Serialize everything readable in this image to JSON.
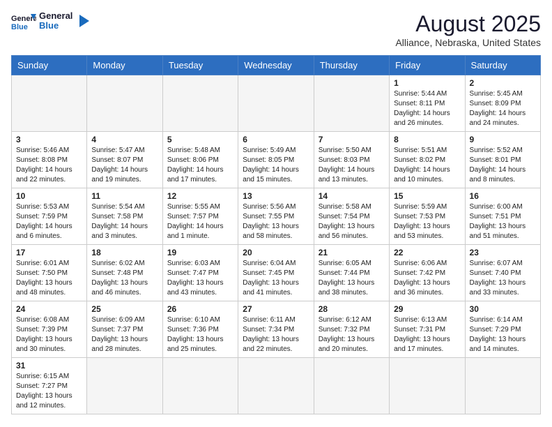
{
  "header": {
    "logo_general": "General",
    "logo_blue": "Blue",
    "month_title": "August 2025",
    "location": "Alliance, Nebraska, United States"
  },
  "weekdays": [
    "Sunday",
    "Monday",
    "Tuesday",
    "Wednesday",
    "Thursday",
    "Friday",
    "Saturday"
  ],
  "weeks": [
    [
      {
        "day": "",
        "info": ""
      },
      {
        "day": "",
        "info": ""
      },
      {
        "day": "",
        "info": ""
      },
      {
        "day": "",
        "info": ""
      },
      {
        "day": "",
        "info": ""
      },
      {
        "day": "1",
        "info": "Sunrise: 5:44 AM\nSunset: 8:11 PM\nDaylight: 14 hours and 26 minutes."
      },
      {
        "day": "2",
        "info": "Sunrise: 5:45 AM\nSunset: 8:09 PM\nDaylight: 14 hours and 24 minutes."
      }
    ],
    [
      {
        "day": "3",
        "info": "Sunrise: 5:46 AM\nSunset: 8:08 PM\nDaylight: 14 hours and 22 minutes."
      },
      {
        "day": "4",
        "info": "Sunrise: 5:47 AM\nSunset: 8:07 PM\nDaylight: 14 hours and 19 minutes."
      },
      {
        "day": "5",
        "info": "Sunrise: 5:48 AM\nSunset: 8:06 PM\nDaylight: 14 hours and 17 minutes."
      },
      {
        "day": "6",
        "info": "Sunrise: 5:49 AM\nSunset: 8:05 PM\nDaylight: 14 hours and 15 minutes."
      },
      {
        "day": "7",
        "info": "Sunrise: 5:50 AM\nSunset: 8:03 PM\nDaylight: 14 hours and 13 minutes."
      },
      {
        "day": "8",
        "info": "Sunrise: 5:51 AM\nSunset: 8:02 PM\nDaylight: 14 hours and 10 minutes."
      },
      {
        "day": "9",
        "info": "Sunrise: 5:52 AM\nSunset: 8:01 PM\nDaylight: 14 hours and 8 minutes."
      }
    ],
    [
      {
        "day": "10",
        "info": "Sunrise: 5:53 AM\nSunset: 7:59 PM\nDaylight: 14 hours and 6 minutes."
      },
      {
        "day": "11",
        "info": "Sunrise: 5:54 AM\nSunset: 7:58 PM\nDaylight: 14 hours and 3 minutes."
      },
      {
        "day": "12",
        "info": "Sunrise: 5:55 AM\nSunset: 7:57 PM\nDaylight: 14 hours and 1 minute."
      },
      {
        "day": "13",
        "info": "Sunrise: 5:56 AM\nSunset: 7:55 PM\nDaylight: 13 hours and 58 minutes."
      },
      {
        "day": "14",
        "info": "Sunrise: 5:58 AM\nSunset: 7:54 PM\nDaylight: 13 hours and 56 minutes."
      },
      {
        "day": "15",
        "info": "Sunrise: 5:59 AM\nSunset: 7:53 PM\nDaylight: 13 hours and 53 minutes."
      },
      {
        "day": "16",
        "info": "Sunrise: 6:00 AM\nSunset: 7:51 PM\nDaylight: 13 hours and 51 minutes."
      }
    ],
    [
      {
        "day": "17",
        "info": "Sunrise: 6:01 AM\nSunset: 7:50 PM\nDaylight: 13 hours and 48 minutes."
      },
      {
        "day": "18",
        "info": "Sunrise: 6:02 AM\nSunset: 7:48 PM\nDaylight: 13 hours and 46 minutes."
      },
      {
        "day": "19",
        "info": "Sunrise: 6:03 AM\nSunset: 7:47 PM\nDaylight: 13 hours and 43 minutes."
      },
      {
        "day": "20",
        "info": "Sunrise: 6:04 AM\nSunset: 7:45 PM\nDaylight: 13 hours and 41 minutes."
      },
      {
        "day": "21",
        "info": "Sunrise: 6:05 AM\nSunset: 7:44 PM\nDaylight: 13 hours and 38 minutes."
      },
      {
        "day": "22",
        "info": "Sunrise: 6:06 AM\nSunset: 7:42 PM\nDaylight: 13 hours and 36 minutes."
      },
      {
        "day": "23",
        "info": "Sunrise: 6:07 AM\nSunset: 7:40 PM\nDaylight: 13 hours and 33 minutes."
      }
    ],
    [
      {
        "day": "24",
        "info": "Sunrise: 6:08 AM\nSunset: 7:39 PM\nDaylight: 13 hours and 30 minutes."
      },
      {
        "day": "25",
        "info": "Sunrise: 6:09 AM\nSunset: 7:37 PM\nDaylight: 13 hours and 28 minutes."
      },
      {
        "day": "26",
        "info": "Sunrise: 6:10 AM\nSunset: 7:36 PM\nDaylight: 13 hours and 25 minutes."
      },
      {
        "day": "27",
        "info": "Sunrise: 6:11 AM\nSunset: 7:34 PM\nDaylight: 13 hours and 22 minutes."
      },
      {
        "day": "28",
        "info": "Sunrise: 6:12 AM\nSunset: 7:32 PM\nDaylight: 13 hours and 20 minutes."
      },
      {
        "day": "29",
        "info": "Sunrise: 6:13 AM\nSunset: 7:31 PM\nDaylight: 13 hours and 17 minutes."
      },
      {
        "day": "30",
        "info": "Sunrise: 6:14 AM\nSunset: 7:29 PM\nDaylight: 13 hours and 14 minutes."
      }
    ],
    [
      {
        "day": "31",
        "info": "Sunrise: 6:15 AM\nSunset: 7:27 PM\nDaylight: 13 hours and 12 minutes."
      },
      {
        "day": "",
        "info": ""
      },
      {
        "day": "",
        "info": ""
      },
      {
        "day": "",
        "info": ""
      },
      {
        "day": "",
        "info": ""
      },
      {
        "day": "",
        "info": ""
      },
      {
        "day": "",
        "info": ""
      }
    ]
  ]
}
